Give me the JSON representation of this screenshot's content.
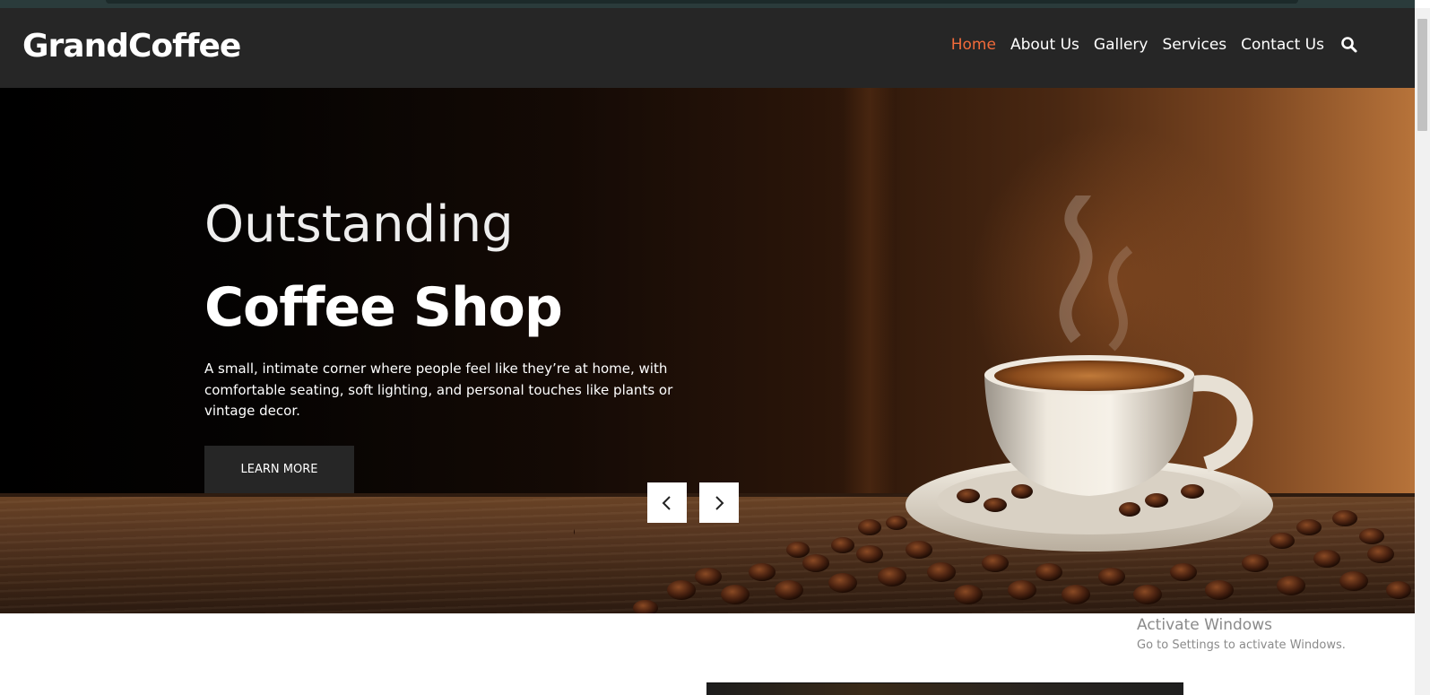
{
  "site": {
    "logo": "GrandCoffee"
  },
  "nav": {
    "items": [
      "Home",
      "About Us",
      "Gallery",
      "Services",
      "Contact Us"
    ],
    "active": "Home",
    "search_icon": "search-icon"
  },
  "hero": {
    "subtitle": "Outstanding",
    "title": "Coffee Shop",
    "description": "A small, intimate corner where people feel like they’re at home, with comfortable seating, soft lighting, and personal touches like plants or vintage decor.",
    "button_label": "LEARN MORE",
    "prev_icon": "chevron-left-icon",
    "next_icon": "chevron-right-icon"
  },
  "watermark": {
    "title": "Activate Windows",
    "subtitle": "Go to Settings to activate Windows."
  },
  "colors": {
    "accent": "#f26b3a",
    "navbar": "#262626",
    "button": "#262626"
  }
}
